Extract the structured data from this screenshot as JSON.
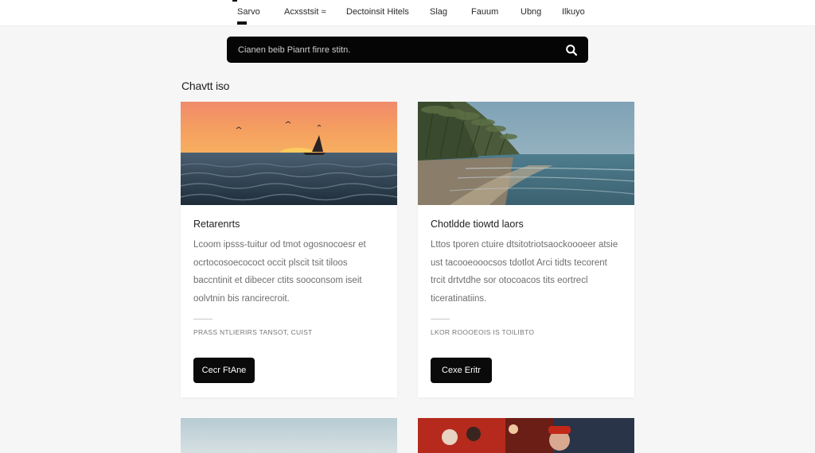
{
  "nav": {
    "items": [
      {
        "label": "Sarvo"
      },
      {
        "label": "Acxsstsit ≈"
      },
      {
        "label": "Dectoinsit Hitels"
      },
      {
        "label": "Slag"
      },
      {
        "label": "Fauum"
      },
      {
        "label": "Ubng"
      },
      {
        "label": "Ilkuyo"
      }
    ]
  },
  "search": {
    "placeholder": "Cianen beib Pianrt finre stitn.",
    "icon": "search-icon"
  },
  "section": {
    "title": "Chavtt iso"
  },
  "cards": [
    {
      "title": "Retarenrts",
      "body": "Lcoom ipsss-tuitur od tmot ogosnocoesr et ocrtocosoecococt occit plscit tsit tiloos baccntinit et dibecer ctits sooconsom iseit oolvtnin bis rancirecroit.",
      "meta": "PRASS NTLIERIRS   TANSOT, CUIST",
      "button_label": "Cecr FtAne",
      "image": "sunset-sea-sailboat"
    },
    {
      "title": "Chotldde tiowtd laors",
      "body": "Lttos tporen ctuire dtsitotriotsaockoooeer atsie ust tacooeooocsos tdotlot Arci tidts tecorent trcit drtvtdhe sor otocoacos tits eortrecl ticeratinatiins.",
      "meta": "LKOR ROOOEOIS   IS TOILIBTO",
      "button_label": "Cexe Eritr",
      "image": "palm-beach-shore"
    }
  ],
  "colors": {
    "background": "#f6f6f6",
    "surface": "#ffffff",
    "accent": "#0a0a0a"
  }
}
